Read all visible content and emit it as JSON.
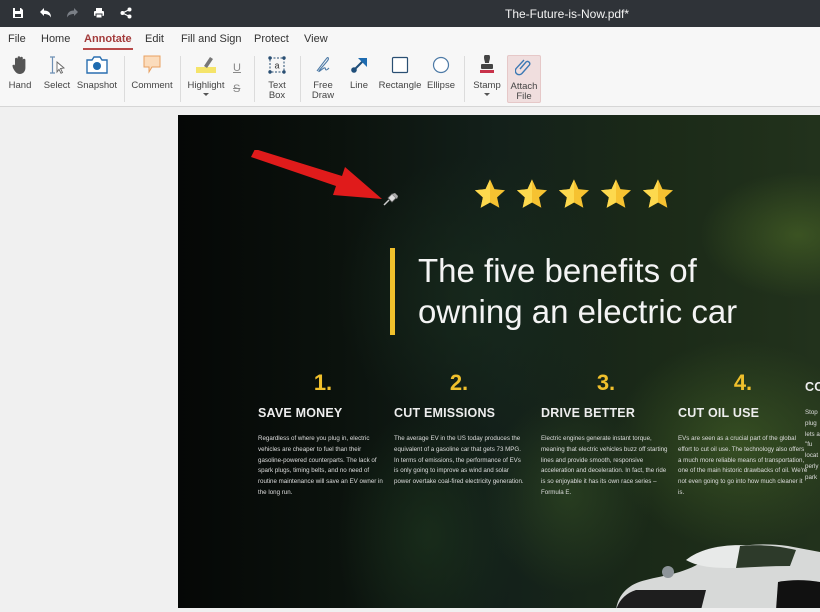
{
  "window": {
    "title": "The-Future-is-Now.pdf*",
    "quick_access": [
      {
        "name": "save-icon"
      },
      {
        "name": "undo-icon"
      },
      {
        "name": "redo-icon"
      },
      {
        "name": "print-icon"
      },
      {
        "name": "share-icon"
      }
    ]
  },
  "menu": {
    "items": [
      "File",
      "Home",
      "Annotate",
      "Edit",
      "Fill and Sign",
      "Protect",
      "View"
    ],
    "active": "Annotate"
  },
  "ribbon": {
    "hand": "Hand",
    "select": "Select",
    "snapshot": "Snapshot",
    "comment": "Comment",
    "highlight": "Highlight",
    "underline": "U",
    "strikethrough": "S",
    "text_box_1": "Text",
    "text_box_2": "Box",
    "free_draw_1": "Free",
    "free_draw_2": "Draw",
    "line": "Line",
    "rectangle": "Rectangle",
    "ellipse": "Ellipse",
    "stamp": "Stamp",
    "attach_1": "Attach",
    "attach_2": "File",
    "selected_tool": "Attach File"
  },
  "document": {
    "rating_stars": 5,
    "headline_1": "The five benefits of",
    "headline_2": "owning an electric car",
    "accent_color": "#f0c02c",
    "annotation_arrow_color": "#e01b1b",
    "benefits": [
      {
        "num": "1.",
        "title": "SAVE MONEY",
        "body": "Regardless of where you plug in, electric vehicles are cheaper to fuel than their gasoline-powered counterparts. The lack of spark plugs, timing belts, and no need of routine maintenance will save an EV owner in the long run."
      },
      {
        "num": "2.",
        "title": "CUT EMISSIONS",
        "body": "The average EV in the US today produces the equivalent of a gasoline car that gets 73 MPG. In terms of emissions, the performance of EVs is only going to improve as wind and solar power overtake coal-fired electricity generation."
      },
      {
        "num": "3.",
        "title": "DRIVE BETTER",
        "body": "Electric engines generate instant torque, meaning that electric vehicles buzz off starting lines and provide smooth, responsive acceleration and deceleration. In fact, the ride is so enjoyable it has its own race series – Formula E."
      },
      {
        "num": "4.",
        "title": "CUT OIL USE",
        "body": "EVs are seen as a crucial part of the global effort to cut oil use. The technology also offers a much more reliable means of transportation, one of the main historic drawbacks of oil. We're not even going to go into how much cleaner it is."
      },
      {
        "num": "",
        "title": "CO",
        "body": "Stop plug lets a \"fu locat perly park"
      }
    ]
  }
}
